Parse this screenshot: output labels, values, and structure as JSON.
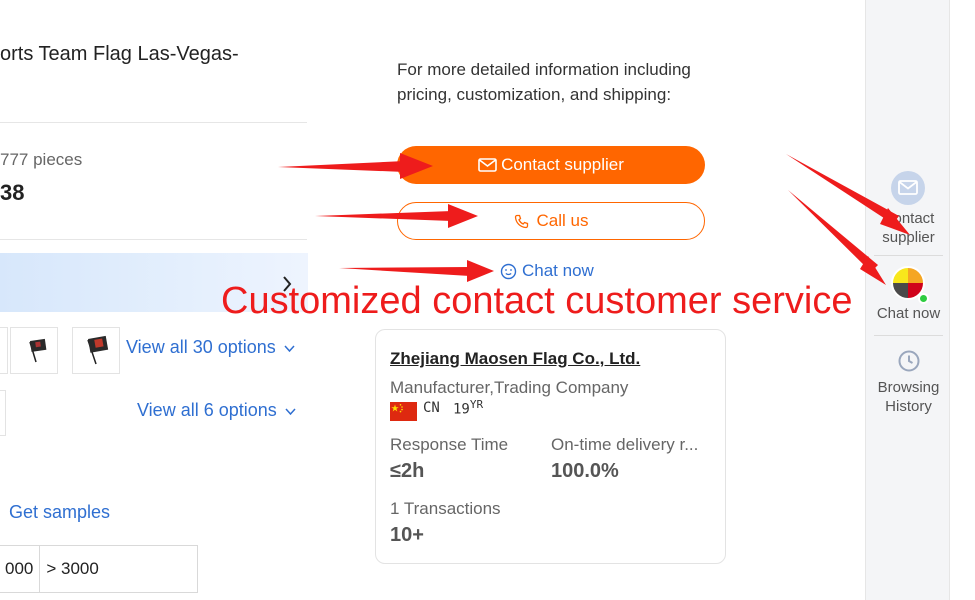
{
  "product": {
    "title_fragment": "orts Team Flag Las-Vegas-",
    "moq_fragment": "777 pieces",
    "price_fragment": "38"
  },
  "options": {
    "view_all_1": "View all 30 options",
    "view_all_2": "View all 6 options",
    "get_samples": "Get samples"
  },
  "price_table": {
    "cells": [
      "000",
      "> 3000"
    ]
  },
  "contact": {
    "info_text": "For more detailed information including pricing, customization, and shipping:",
    "contact_supplier_label": "Contact supplier",
    "call_us_label": "Call us",
    "chat_now_label": "Chat now"
  },
  "annotation": {
    "text": "Customized contact customer service",
    "color": "#ee1c1c"
  },
  "supplier": {
    "name": "Zhejiang Maosen Flag Co., Ltd.",
    "type": "Manufacturer,Trading Company",
    "country": "CN",
    "years": "19YR",
    "response_time_label": "Response Time",
    "response_time_value": "≤2h",
    "ontime_label": "On-time delivery r...",
    "ontime_value": "100.0%",
    "transactions_label": "1 Transactions",
    "transactions_value": "10+"
  },
  "sidebar": {
    "contact_supplier": "Contact supplier",
    "chat_now": "Chat now",
    "browsing_history": "Browsing History"
  },
  "colors": {
    "accent_orange": "#ff6600",
    "link_blue": "#2f6fd1",
    "arrow_red": "#ee1c1c"
  }
}
